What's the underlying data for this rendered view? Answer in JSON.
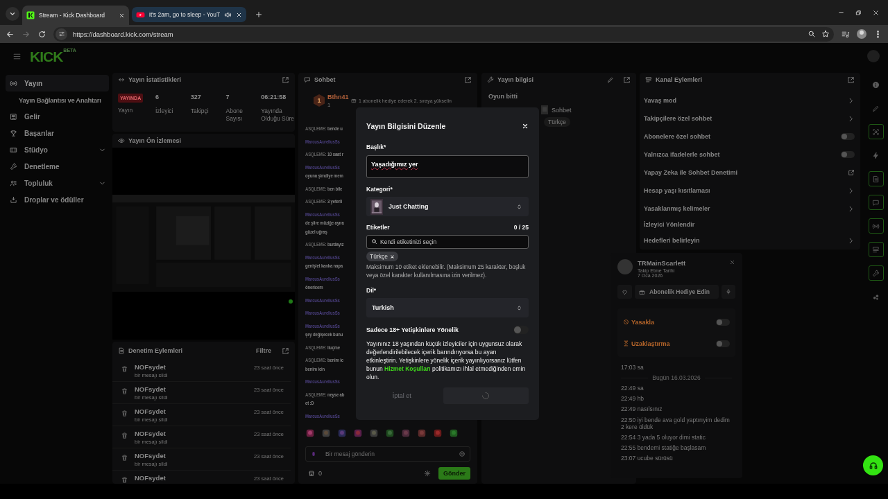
{
  "browser": {
    "tabs": [
      {
        "title": "Stream - Kick Dashboard",
        "kind": "kick",
        "selected": true,
        "audio": false
      },
      {
        "title": "it's 2am, go to sleep - YouT",
        "kind": "youtube",
        "selected": false,
        "audio": true
      }
    ],
    "nav": [
      {
        "kind": "back",
        "disabled": false
      },
      {
        "kind": "forward",
        "disabled": true
      },
      {
        "kind": "reload",
        "disabled": false
      }
    ],
    "url": "https://dashboard.kick.com/stream"
  },
  "header": {
    "logo": "KICK",
    "logo_badge": "BETA"
  },
  "sidebar": [
    {
      "label": "Yayın",
      "kind": "item",
      "selected": true
    },
    {
      "label": "Yayın Bağlantısı ve Anahtarı",
      "kind": "sub",
      "selected": false
    },
    {
      "label": "Gelir",
      "kind": "item",
      "selected": false
    },
    {
      "label": "Başarılar",
      "kind": "item",
      "selected": false
    },
    {
      "label": "Stüdyo",
      "kind": "group",
      "selected": false,
      "expanded": false
    },
    {
      "label": "Denetleme",
      "kind": "item",
      "selected": false
    },
    {
      "label": "Topluluk",
      "kind": "group",
      "selected": false,
      "expanded": false
    },
    {
      "label": "Droplar ve ödüller",
      "kind": "item",
      "selected": false
    }
  ],
  "stats": {
    "title": "Yayın İstatistikleri",
    "status": "YAYINDA",
    "status_label": "Yayın",
    "items": [
      {
        "value": "6",
        "label": "İzleyici"
      },
      {
        "value": "327",
        "label": "Takipçi"
      },
      {
        "value": "7",
        "label": "Abone Sayısı"
      },
      {
        "value": "06:21:58",
        "label": "Yayında Olduğu Süre"
      }
    ]
  },
  "preview": {
    "title": "Yayın Ön İzlemesi"
  },
  "moderation": {
    "title": "Denetim Eylemleri",
    "filter": "Filtre",
    "rows": [
      {
        "user": "NOFsydet",
        "action": "bir mesajı sildi",
        "time": "23 saat önce"
      },
      {
        "user": "NOFsydet",
        "action": "bir mesajı sildi",
        "time": "23 saat önce"
      },
      {
        "user": "NOFsydet",
        "action": "bir mesajı sildi",
        "time": "23 saat önce"
      },
      {
        "user": "NOFsydet",
        "action": "bir mesajı sildi",
        "time": "23 saat önce"
      },
      {
        "user": "NOFsydet",
        "action": "bir mesajı sildi",
        "time": "23 saat önce"
      },
      {
        "user": "NOFsydet",
        "time": "23 saat önce"
      }
    ]
  },
  "chat": {
    "title": "Sohbet",
    "leader": {
      "rank": "1",
      "user": "Bthn41",
      "count": "1",
      "promo": "1 abonelik hediye ederek 2. sıraya yükselin"
    },
    "messages": [
      {
        "user": "ASQLEME:",
        "color": "#5e5e5e",
        "text": "bende u"
      },
      {
        "user": "MarcusAureliusSs",
        "color": "#4a3f7e"
      },
      {
        "user": "ASQLEME:",
        "color": "#5e5e5e",
        "text": "10 saat r"
      },
      {
        "user": "MarcusAureliusSs",
        "color": "#4a3f7e",
        "lines": [
          "oyuna şimdiye mem"
        ]
      },
      {
        "user": "ASQLEME:",
        "color": "#5e5e5e",
        "text": "ben bile"
      },
      {
        "user": "ASQLEME:",
        "color": "#5e5e5e",
        "text": "3 yeterli"
      },
      {
        "user": "MarcusAureliusSs",
        "color": "#4a3f7e",
        "lines": [
          "de şiire müziğe ayıra",
          "güzel uğraş"
        ]
      },
      {
        "user": "ASQLEME:",
        "color": "#5e5e5e",
        "text": "burdayız"
      },
      {
        "user": "MarcusAureliusSs",
        "color": "#4a3f7e",
        "lines": [
          "genişlet kanka napa"
        ]
      },
      {
        "user": "MarcusAureliusSs",
        "color": "#4a3f7e",
        "lines": [
          "önericem"
        ]
      },
      {
        "user": "MarcusAureliusSs",
        "color": "#4a3f7e"
      },
      {
        "user": "MarcusAureliusSs",
        "color": "#4a3f7e"
      },
      {
        "user": "MarcusAureliusSs",
        "color": "#4a3f7e",
        "lines": [
          "şey değişecek bunu"
        ]
      },
      {
        "user": "ASQLEME:",
        "color": "#5e5e5e",
        "text": "liuçme"
      },
      {
        "user": "ASQLEME:",
        "color": "#5e5e5e",
        "text": "benim ic",
        "lines": [
          "benim icin"
        ]
      },
      {
        "user": "MarcusAureliusSs",
        "color": "#4a3f7e"
      },
      {
        "user": "ASQLEME:",
        "color": "#5e5e5e",
        "text": "neyse ab",
        "lines": [
          "et :D"
        ]
      },
      {
        "user": "MarcusAureliusSs",
        "color": "#4a3f7e"
      }
    ],
    "placeholder": "Bir mesaj gönderin",
    "points": "0",
    "send": "Gönder"
  },
  "info": {
    "title": "Yayın bilgisi",
    "status": "Oyun bitti",
    "category": "Sohbet",
    "tags": [
      "Türkçe"
    ]
  },
  "actions": {
    "title": "Kanal Eylemleri",
    "items": [
      {
        "label": "Yavaş mod",
        "kind": "link"
      },
      {
        "label": "Takipçilere özel sohbet",
        "kind": "link"
      },
      {
        "label": "Abonelere özel sohbet",
        "kind": "toggle",
        "on": false
      },
      {
        "label": "Yalnızca ifadelerle sohbet",
        "kind": "toggle",
        "on": false
      },
      {
        "label": "Yapay Zeka ile Sohbet Denetimi",
        "kind": "external"
      },
      {
        "label": "Hesap yaşı kısıtlaması",
        "kind": "link"
      },
      {
        "label": "Yasaklanmış kelimeler",
        "kind": "link"
      },
      {
        "label": "İzleyici Yönlendir",
        "kind": "plain"
      },
      {
        "label": "Hedefleri belirleyin",
        "kind": "link"
      }
    ]
  },
  "user_card": {
    "name": "TRMainScarlett",
    "follow_label": "Takip Etme Tarihi",
    "follow_date": "7 Oca 2026",
    "gift": "Abonelik Hediye Edin",
    "moderation": [
      {
        "label": "Yasakla",
        "kind": "ban",
        "on": false
      },
      {
        "label": "Uzaklaştırma",
        "kind": "timeout",
        "on": false
      }
    ],
    "history": [
      {
        "time": "17:03",
        "text": "sa"
      }
    ],
    "divider": "Bugün 16.03.2026",
    "today": [
      {
        "time": "22:49",
        "text": "sa"
      },
      {
        "time": "22:49",
        "text": "hb"
      },
      {
        "time": "22:49",
        "text": "nasılsınız"
      },
      {
        "time": "22:50",
        "text": "iyi bende ava gold yaptırıyim dedim 2 kere öldük"
      },
      {
        "time": "22:54",
        "text": "3 yada 5 oluyor dimi static"
      },
      {
        "time": "22:55",
        "text": "bendemi statiğe başlasam"
      },
      {
        "time": "23:07",
        "text": "ucube sürüsü"
      }
    ]
  },
  "rail": [
    {
      "selected": false
    },
    {
      "selected": false
    },
    {
      "selected": true
    },
    {
      "selected": false
    },
    {
      "selected": true
    },
    {
      "selected": true
    },
    {
      "selected": true
    },
    {
      "selected": true
    },
    {
      "selected": true
    },
    {
      "selected": false
    }
  ],
  "modal": {
    "title": "Yayın Bilgisini Düzenle",
    "title_label": "Başlık*",
    "title_value": "Yaşadığımız yer",
    "category_label": "Kategori*",
    "category": "Just Chatting",
    "tags_label": "Etiketler",
    "tags_count": "0 / 25",
    "tags_placeholder": "Kendi etiketinizi seçin",
    "tags": [
      "Türkçe"
    ],
    "tags_hint": "Maksimum 10 etiket eklenebilir. (Maksimum 25 karakter, boşluk veya özel karakter kullanılmasına izin verilmez).",
    "language_label": "Dil*",
    "language": "Turkish",
    "mature_label": "Sadece 18+ Yetişkinlere Yönelik",
    "mature_on": false,
    "mature_before": "Yayınınız 18 yaşından küçük izleyiciler için uygunsuz olarak değerlendirilebilecek içerik barındırıyorsa bu ayarı etkinleştirin. Yetişkinlere yönelik içerik yayınlıyorsanız lütfen bunun",
    "terms_link": "Hizmet Koşulları",
    "mature_after": "politikamızı ihlal etmediğinden emin olun.",
    "cancel": {
      "label": "İptal et",
      "disabled": true
    },
    "saving": true
  }
}
